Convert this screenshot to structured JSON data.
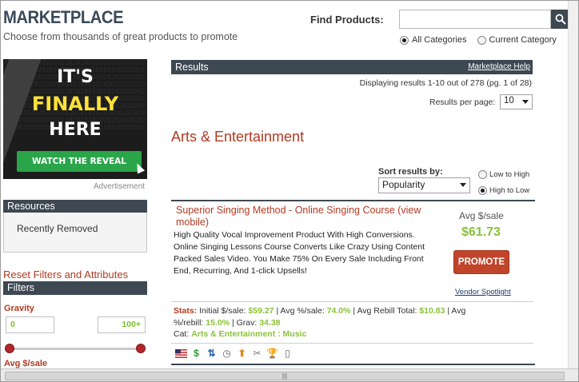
{
  "header": {
    "title": "MARKETPLACE",
    "subtitle": "Choose from thousands of great products to promote"
  },
  "search": {
    "label": "Find Products:",
    "value": "",
    "placeholder": "",
    "scope_options": [
      {
        "label": "All Categories",
        "selected": true
      },
      {
        "label": "Current Category",
        "selected": false
      }
    ]
  },
  "ad": {
    "line1": "IT'S",
    "line2": "FINALLY",
    "line3": "HERE",
    "cta": "WATCH THE REVEAL",
    "caption": "Advertisement",
    "colors": {
      "bg": "#1c1c1c",
      "accent": "#ffe23a",
      "button": "#2aa54a"
    }
  },
  "sidebar": {
    "resources_header": "Resources",
    "recently_removed": "Recently Removed",
    "reset_link": "Reset Filters and Attributes",
    "filters_header": "Filters",
    "gravity_label": "Gravity",
    "gravity_min": "0",
    "gravity_max": "100+",
    "avg_sale_label": "Avg $/sale"
  },
  "results": {
    "header": "Results",
    "help_link": "Marketplace Help",
    "displaying": "Displaying results 1-10 out of 278 (pg. 1 of 28)",
    "per_page_label": "Results per page:",
    "per_page_value": "10",
    "category_title": "Arts & Entertainment",
    "sort_label": "Sort results by:",
    "sort_value": "Popularity",
    "order_options": [
      {
        "label": "Low to High",
        "selected": false
      },
      {
        "label": "High to Low",
        "selected": true
      }
    ]
  },
  "product": {
    "title": "Superior Singing Method - Online Singing Course (view mobile)",
    "description": "High Quality Vocal Improvement Product With High Conversions. Online Singing Lessons Course Converts Like Crazy Using Content Packed Sales Video. You Make 75% On Every Sale Including Front End, Recurring, And 1-click Upsells!",
    "avg_sale_label": "Avg $/sale",
    "avg_sale_value": "$61.73",
    "promote_label": "PROMOTE",
    "vendor_link": "Vendor Spotlight",
    "stats": {
      "label": "Stats:",
      "initial_label": "Initial $/sale:",
      "initial_value": "$59.27",
      "avg_pct_label": "Avg %/sale:",
      "avg_pct_value": "74.0%",
      "rebill_total_label": "Avg Rebill Total:",
      "rebill_total_value": "$10.83",
      "rebill_pct_label": "Avg %/rebill:",
      "rebill_pct_value": "15.0%",
      "grav_label": "Grav:",
      "grav_value": "34.38",
      "cat_label": "Cat:",
      "cat_value": "Arts & Entertainment : Music"
    },
    "icons": [
      "us-flag-icon",
      "dollar-icon",
      "recurring-icon",
      "clock-icon",
      "up-arrow-icon",
      "tools-icon",
      "trophy-icon",
      "mobile-icon"
    ]
  },
  "scrollbar": {
    "grip": "|||"
  }
}
